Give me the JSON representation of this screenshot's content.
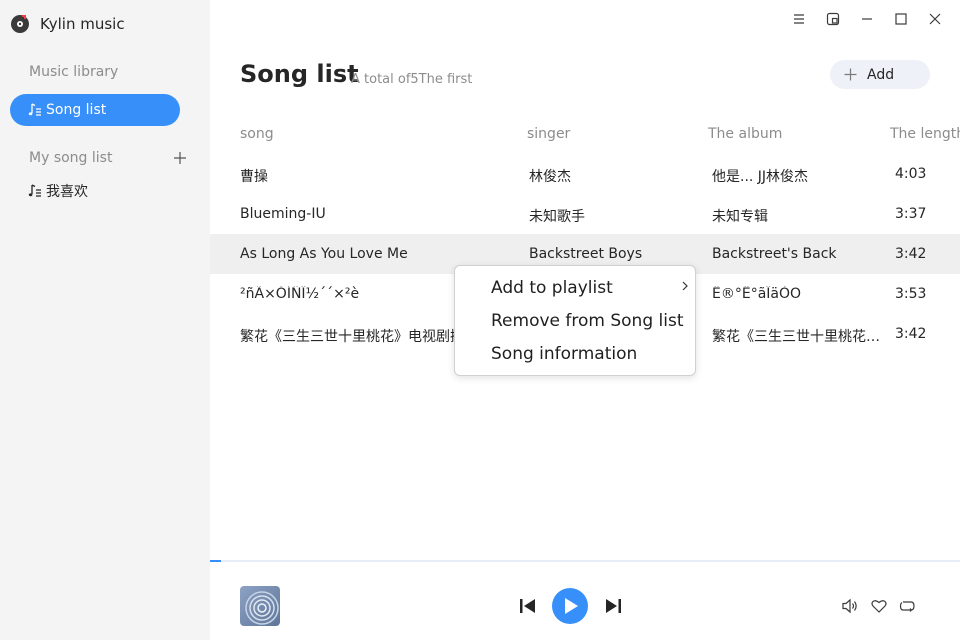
{
  "app": {
    "name": "Kylin music"
  },
  "sidebar": {
    "library_label": "Music library",
    "song_list_label": "Song list",
    "my_song_list_label": "My song list",
    "playlists": [
      {
        "label": "我喜欢"
      }
    ]
  },
  "header": {
    "title": "Song list",
    "subtitle": "A total of5The first",
    "add_label": "Add"
  },
  "table": {
    "columns": {
      "song": "song",
      "singer": "singer",
      "album": "The album",
      "length": "The length"
    },
    "rows": [
      {
        "song": "曹操",
        "singer": "林俊杰",
        "album": "他是... JJ林俊杰",
        "length": "4:03"
      },
      {
        "song": "Blueming-IU",
        "singer": "未知歌手",
        "album": "未知专辑",
        "length": "3:37"
      },
      {
        "song": "As Long As You Love Me",
        "singer": "Backstreet Boys",
        "album": "Backstreet's Back",
        "length": "3:42"
      },
      {
        "song": "²ñÃ×ÓÍÑÎ½´´×²è",
        "singer": "",
        "album": "Ê®°Ë°ãÎäÒÕ",
        "length": "3:53"
      },
      {
        "song": "繁花《三生三世十里桃花》电视剧插曲",
        "singer": "",
        "album": "繁花《三生三世十里桃花》电视剧插曲",
        "length": "3:42"
      }
    ]
  },
  "context_menu": {
    "items": [
      {
        "label": "Add to playlist"
      },
      {
        "label": "Remove from Song list"
      },
      {
        "label": "Song information"
      }
    ]
  },
  "player": {
    "progress": 0.015
  },
  "colors": {
    "accent": "#3790fa",
    "sidebar_bg": "#f4f4f4",
    "selected_row": "#efefef"
  }
}
